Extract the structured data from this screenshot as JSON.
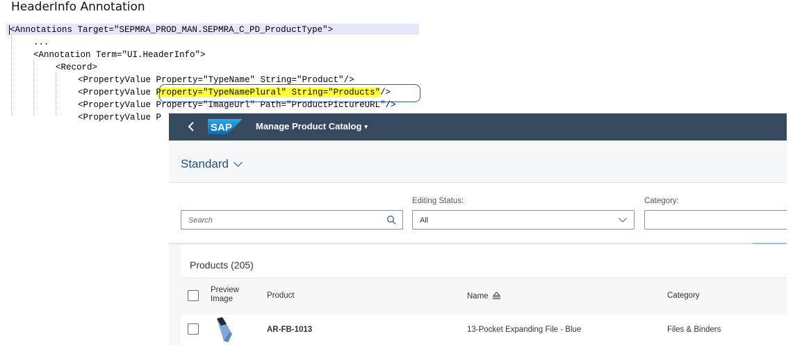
{
  "doc": {
    "title": "HeaderInfo Annotation",
    "code": {
      "line1": "<Annotations Target=\"SEPMRA_PROD_MAN.SEPMRA_C_PD_ProductType\">",
      "line2": "...",
      "line3": "<Annotation Term=\"UI.HeaderInfo\">",
      "line4": "<Record>",
      "line5": "<PropertyValue Property=\"TypeName\" String=\"Product\"/>",
      "line6_pre": "<PropertyValue ",
      "line6_hl": "Property=\"TypeNamePlural\" String=\"Products\"",
      "line6_post": "/>",
      "line7": "<PropertyValue Property=\"ImageUrl\" Path=\"ProductPictureURL\"/>"
    }
  },
  "app": {
    "shell": {
      "back_label": "<",
      "logo_text": "SAP",
      "title": "Manage Product Catalog",
      "title_caret": "▾",
      "brand_color": "#354a5f",
      "logo_color": "#1b7fcc"
    },
    "variant": {
      "label": "Standard"
    },
    "filters": {
      "search_placeholder": "Search",
      "editing_status_label": "Editing Status:",
      "editing_status_value": "All",
      "category_label": "Category:",
      "category_value": ""
    },
    "table": {
      "title": "Products (205)",
      "columns": {
        "preview": "Preview Image",
        "product": "Product",
        "name": "Name",
        "category": "Category"
      },
      "rows": [
        {
          "product": "AR-FB-1013",
          "name": "13-Pocket Expanding File - Blue",
          "category": "Files & Binders",
          "icon": "expanding-file-thumbnail"
        }
      ]
    }
  }
}
